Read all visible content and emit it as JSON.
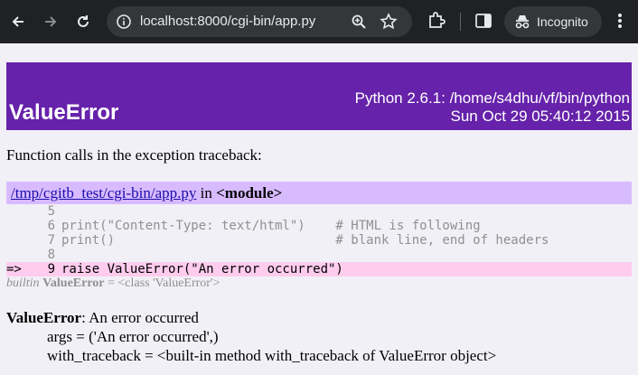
{
  "browser": {
    "url": "localhost:8000/cgi-bin/app.py",
    "incognito_label": "Incognito",
    "colors": {
      "toolbar": "#202124",
      "omnibox": "#35363a",
      "icon": "#e8eaed"
    }
  },
  "page": {
    "exception_name": "ValueError",
    "python_info": "Python 2.6.1: /home/s4dhu/vf/bin/python",
    "timestamp": "Sun Oct 29 05:40:12 2015",
    "intro": "Function calls in the exception traceback:",
    "frame": {
      "file_link": "/tmp/cgitb_test/cgi-bin/app.py",
      "in_text": "in",
      "func": "<module>",
      "lines": [
        {
          "arrow": "",
          "num": "5",
          "code": ""
        },
        {
          "arrow": "",
          "num": "6",
          "code": "print(\"Content-Type: text/html\")    # HTML is following"
        },
        {
          "arrow": "",
          "num": "7",
          "code": "print()                             # blank line, end of headers"
        },
        {
          "arrow": "",
          "num": "8",
          "code": ""
        },
        {
          "arrow": "=>",
          "num": "9",
          "code": "raise ValueError(\"An error occurred\")"
        }
      ],
      "locals": {
        "prefix": "builtin",
        "name": "ValueError",
        "value": "= <class 'ValueError'>"
      }
    },
    "summary": {
      "name": "ValueError",
      "message": ": An error occurred",
      "args": "args = ('An error occurred',)",
      "with_traceback": "with_traceback = <built-in method with_traceback of ValueError object>"
    },
    "colors": {
      "banner": "#6622aa",
      "frame_head": "#d8bbff",
      "highlight": "#ffccee",
      "background": "#f1f0f6"
    }
  }
}
